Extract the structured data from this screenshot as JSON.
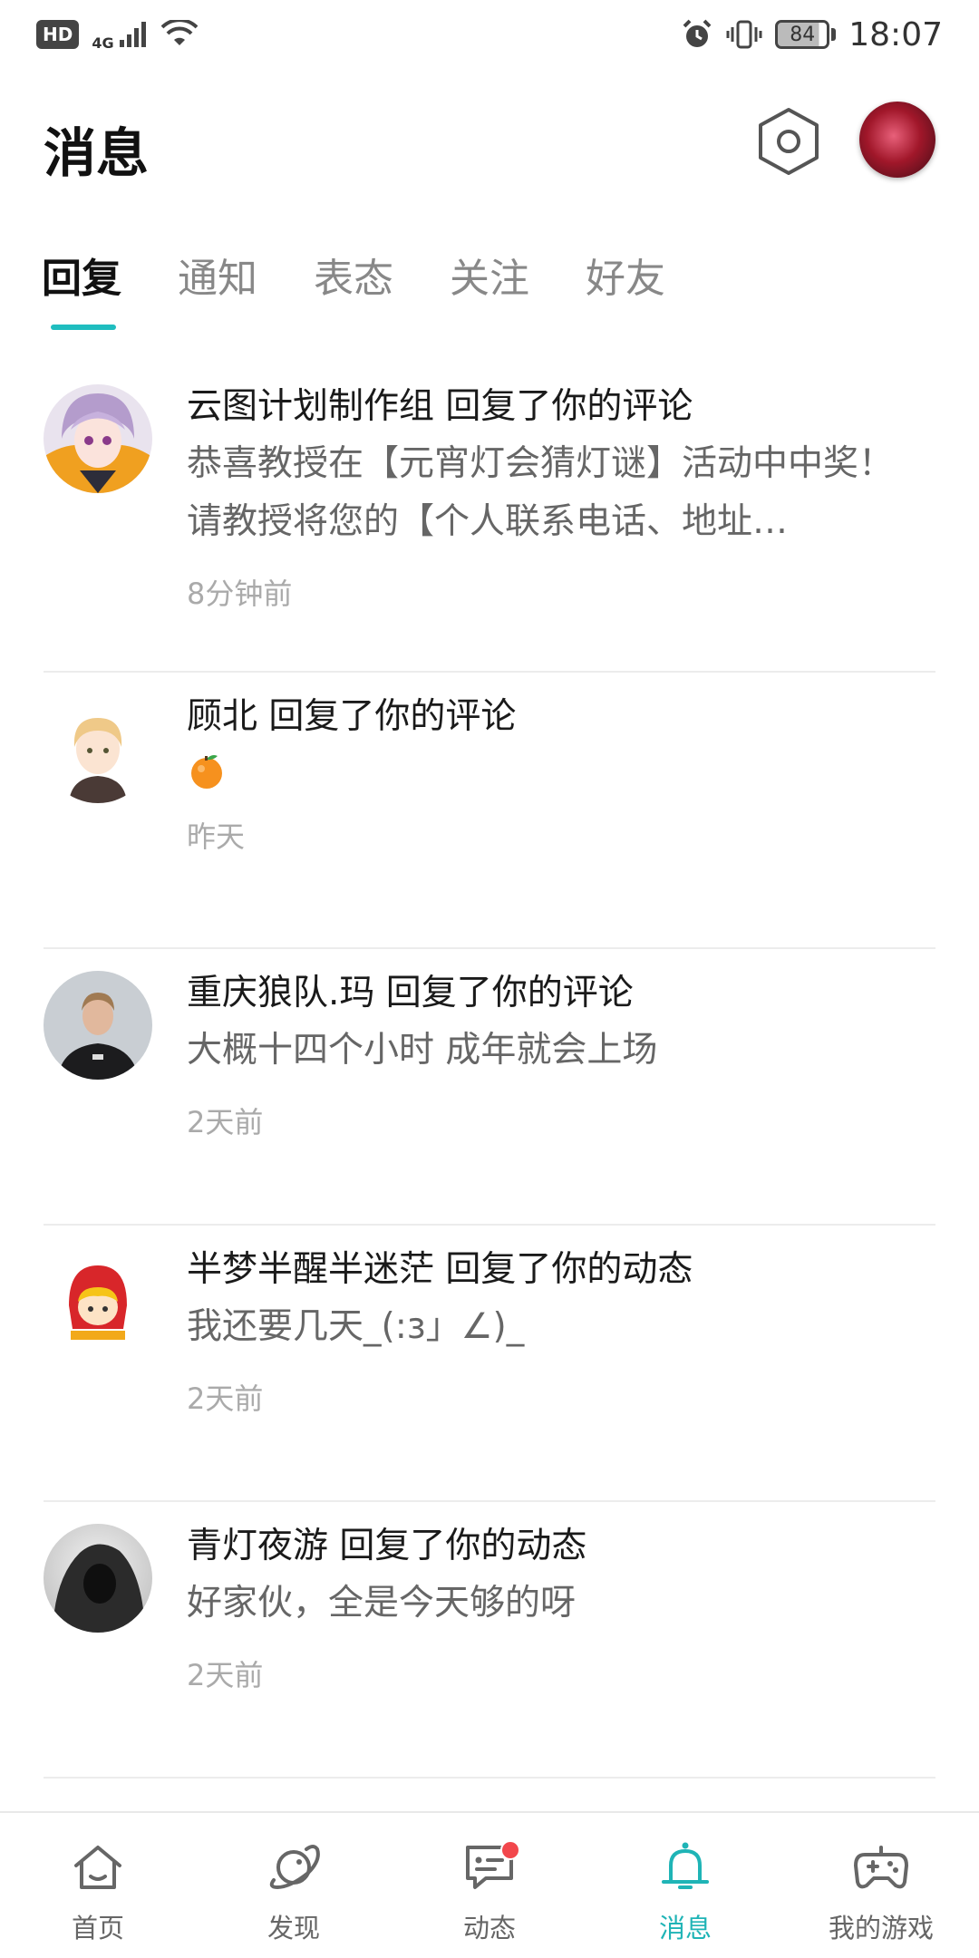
{
  "status_bar": {
    "hd": "HD",
    "network": "4G",
    "battery": "84",
    "time": "18:07"
  },
  "header": {
    "title": "消息"
  },
  "tabs": [
    {
      "label": "回复",
      "active": true
    },
    {
      "label": "通知",
      "active": false
    },
    {
      "label": "表态",
      "active": false
    },
    {
      "label": "关注",
      "active": false
    },
    {
      "label": "好友",
      "active": false
    }
  ],
  "messages": [
    {
      "title": "云图计划制作组 回复了你的评论",
      "text": "恭喜教授在【元宵灯会猜灯谜】活动中中奖！请教授将您的【个人联系电话、地址…",
      "time": "8分钟前"
    },
    {
      "title": "顾北 回复了你的评论",
      "text": "",
      "time": "昨天",
      "emoji": "orange-emoji"
    },
    {
      "title": "重庆狼队.玛 回复了你的评论",
      "text": "大概十四个小时 成年就会上场",
      "time": "2天前"
    },
    {
      "title": "半梦半醒半迷茫 回复了你的动态",
      "text": "我还要几天_(:з」∠)_",
      "time": "2天前"
    },
    {
      "title": "青灯夜游 回复了你的动态",
      "text": "好家伙，全是今天够的呀",
      "time": "2天前"
    }
  ],
  "bottom_nav": [
    {
      "label": "首页",
      "icon": "home-icon",
      "active": false
    },
    {
      "label": "发现",
      "icon": "planet-icon",
      "active": false
    },
    {
      "label": "动态",
      "icon": "chat-icon",
      "active": false,
      "badge": true
    },
    {
      "label": "消息",
      "icon": "bell-icon",
      "active": true
    },
    {
      "label": "我的游戏",
      "icon": "gamepad-icon",
      "active": false
    }
  ],
  "colors": {
    "accent": "#1fbdbf",
    "badge": "#f2474c"
  }
}
